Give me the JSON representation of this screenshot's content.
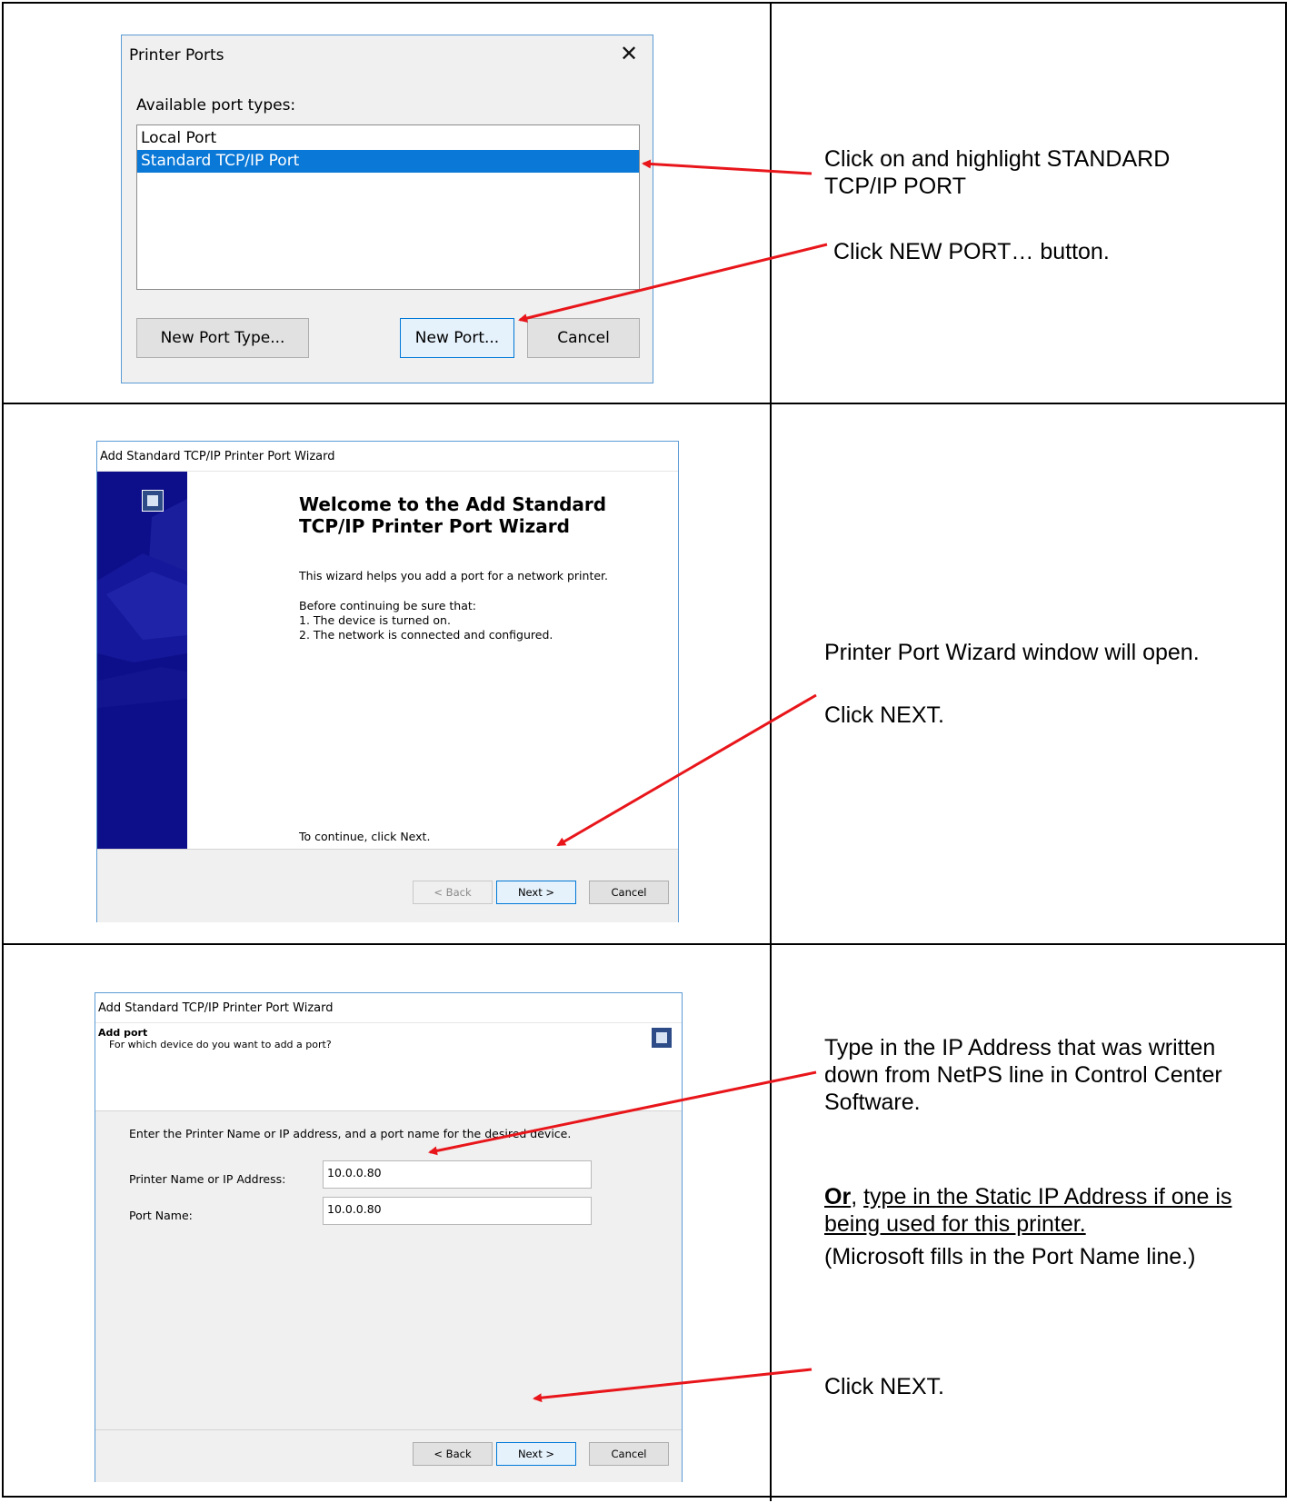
{
  "printer_ports": {
    "title": "Printer Ports",
    "close_glyph": "✕",
    "available_label": "Available port types:",
    "items": [
      "Local Port",
      "Standard TCP/IP Port"
    ],
    "new_port_type_label": "New Port Type...",
    "new_port_label": "New Port...",
    "cancel_label": "Cancel"
  },
  "wizard_welcome": {
    "title": "Add Standard TCP/IP Printer Port Wizard",
    "heading": "Welcome to the Add Standard TCP/IP Printer Port Wizard",
    "intro": "This wizard helps you add a port for a network printer.",
    "before": "Before continuing be sure that:",
    "step1": "1.  The device is turned on.",
    "step2": "2.  The network is connected and configured.",
    "continue": "To continue, click Next.",
    "back_label": "< Back",
    "next_label": "Next >",
    "cancel_label": "Cancel"
  },
  "wizard_addport": {
    "title": "Add Standard TCP/IP Printer Port Wizard",
    "header_title": "Add port",
    "header_subtitle": "For which device do you want to add a port?",
    "instruction": "Enter the Printer Name or IP address, and a port name for the desired device.",
    "ip_label": "Printer Name or IP Address:",
    "ip_value": "10.0.0.80",
    "port_label": "Port Name:",
    "port_value": "10.0.0.80",
    "back_label": "< Back",
    "next_label": "Next >",
    "cancel_label": "Cancel"
  },
  "instructions": {
    "row1_a": "Click on and highlight STANDARD TCP/IP PORT",
    "row1_b": "Click NEW PORT… button.",
    "row2_a": "Printer Port Wizard window will open.",
    "row2_b": "Click NEXT.",
    "row3_a": "Type in the IP Address that was written down from NetPS line in Control Center Software.",
    "row3_or": "Or",
    "row3_sep": ", ",
    "row3_b": "type in the Static IP Address if one is being used for this printer.",
    "row3_c": "(Microsoft fills in the Port Name line.)",
    "row3_d": "Click NEXT."
  },
  "colors": {
    "arrow": "#e8161b",
    "selection": "#0a78d7",
    "wizard_side": "#0d0f8a",
    "dialog_border": "#5b9bd5"
  }
}
